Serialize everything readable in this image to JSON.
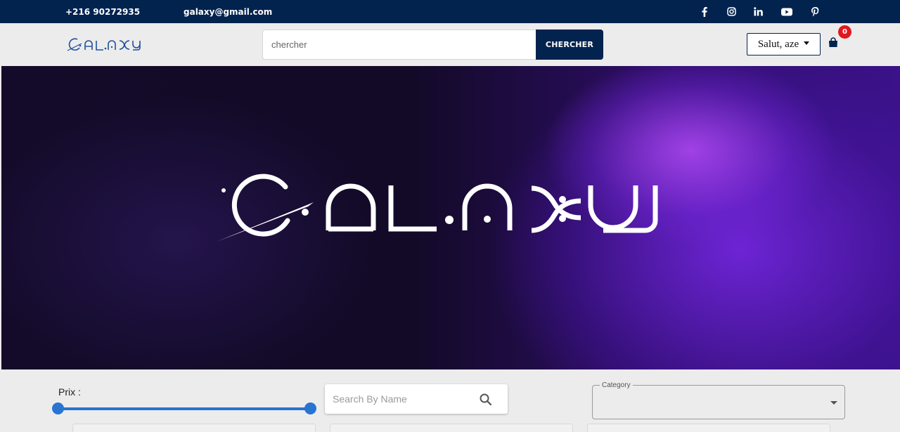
{
  "topbar": {
    "phone": "+216 90272935",
    "email": "galaxy@gmail.com",
    "social": [
      "facebook-icon",
      "instagram-icon",
      "linkedin-icon",
      "youtube-icon",
      "pinterest-icon"
    ]
  },
  "header": {
    "logo_text": "GALAXY",
    "search_placeholder": "chercher",
    "search_button": "CHERCHER",
    "user_greeting": "Salut, aze",
    "cart_count": "0"
  },
  "hero": {
    "logo_text": "GALAXY"
  },
  "filters": {
    "price_label": "Prix :",
    "price_range": [
      0,
      1
    ],
    "name_search_placeholder": "Search By Name",
    "category_label": "Category",
    "category_value": ""
  },
  "colors": {
    "navy": "#03234f",
    "badge_red": "#e0181e",
    "slider_blue": "#2874d0",
    "hero_purple": "#3b128a"
  }
}
